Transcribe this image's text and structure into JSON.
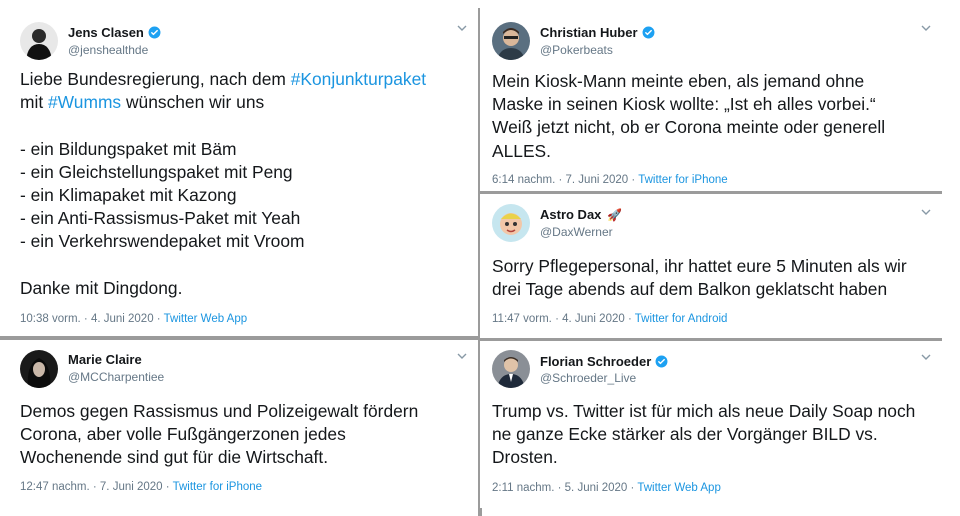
{
  "colors": {
    "link": "#1b95e0",
    "muted": "#657786",
    "text": "#14171a",
    "divider": "#9b9b9b",
    "verified": "#1da1f2"
  },
  "tweets": {
    "t1": {
      "name": "Jens Clasen",
      "handle": "@jenshealthde",
      "verified": true,
      "lines": [
        [
          "Liebe Bundesregierung, nach dem ",
          "#Konjunkturpaket"
        ],
        [
          "mit ",
          "#Wumms",
          " wünschen wir uns"
        ],
        [
          ""
        ],
        [
          "- ein Bildungspaket mit Bäm"
        ],
        [
          "- ein Gleichstellungspaket mit Peng"
        ],
        [
          "- ein Klimapaket mit Kazong"
        ],
        [
          "- ein Anti-Rassismus-Paket mit Yeah"
        ],
        [
          "- ein Verkehrswendepaket mit Vroom"
        ],
        [
          ""
        ],
        [
          "Danke mit Dingdong."
        ]
      ],
      "time": "10:38 vorm. · 4. Juni 2020 · ",
      "source": "Twitter Web App"
    },
    "t2": {
      "name": "Christian Huber",
      "handle": "@Pokerbeats",
      "verified": true,
      "lines": [
        "Mein Kiosk-Mann meinte eben, als jemand ohne",
        "Maske in seinen Kiosk wollte: „Ist eh alles vorbei.“",
        "Weiß jetzt nicht, ob er Corona meinte oder generell",
        "ALLES."
      ],
      "time": "6:14 nachm. · 7. Juni 2020 · ",
      "source": "Twitter for iPhone"
    },
    "t3": {
      "name": "Astro Dax",
      "handle": "@DaxWerner",
      "verified": false,
      "emoji": "🚀",
      "lines": [
        "Sorry Pflegepersonal, ihr hattet eure 5 Minuten als wir",
        "drei Tage abends auf dem Balkon geklatscht haben"
      ],
      "time": "11:47 vorm. · 4. Juni 2020 · ",
      "source": "Twitter for Android"
    },
    "t4": {
      "name": "Marie Claire",
      "handle": "@MCCharpentiee",
      "verified": false,
      "lines": [
        "Demos gegen Rassismus und Polizeigewalt fördern",
        "Corona, aber volle Fußgängerzonen jedes",
        "Wochenende sind gut für die Wirtschaft."
      ],
      "time": "12:47 nachm. · 7. Juni 2020 · ",
      "source": "Twitter for iPhone"
    },
    "t5": {
      "name": "Florian Schroeder",
      "handle": "@Schroeder_Live",
      "verified": true,
      "lines": [
        "Trump vs. Twitter ist für mich als neue Daily Soap noch",
        "ne ganze Ecke stärker als der Vorgänger BILD vs.",
        "Drosten."
      ],
      "time": "2:11 nachm. · 5. Juni 2020 · ",
      "source": "Twitter Web App"
    }
  }
}
